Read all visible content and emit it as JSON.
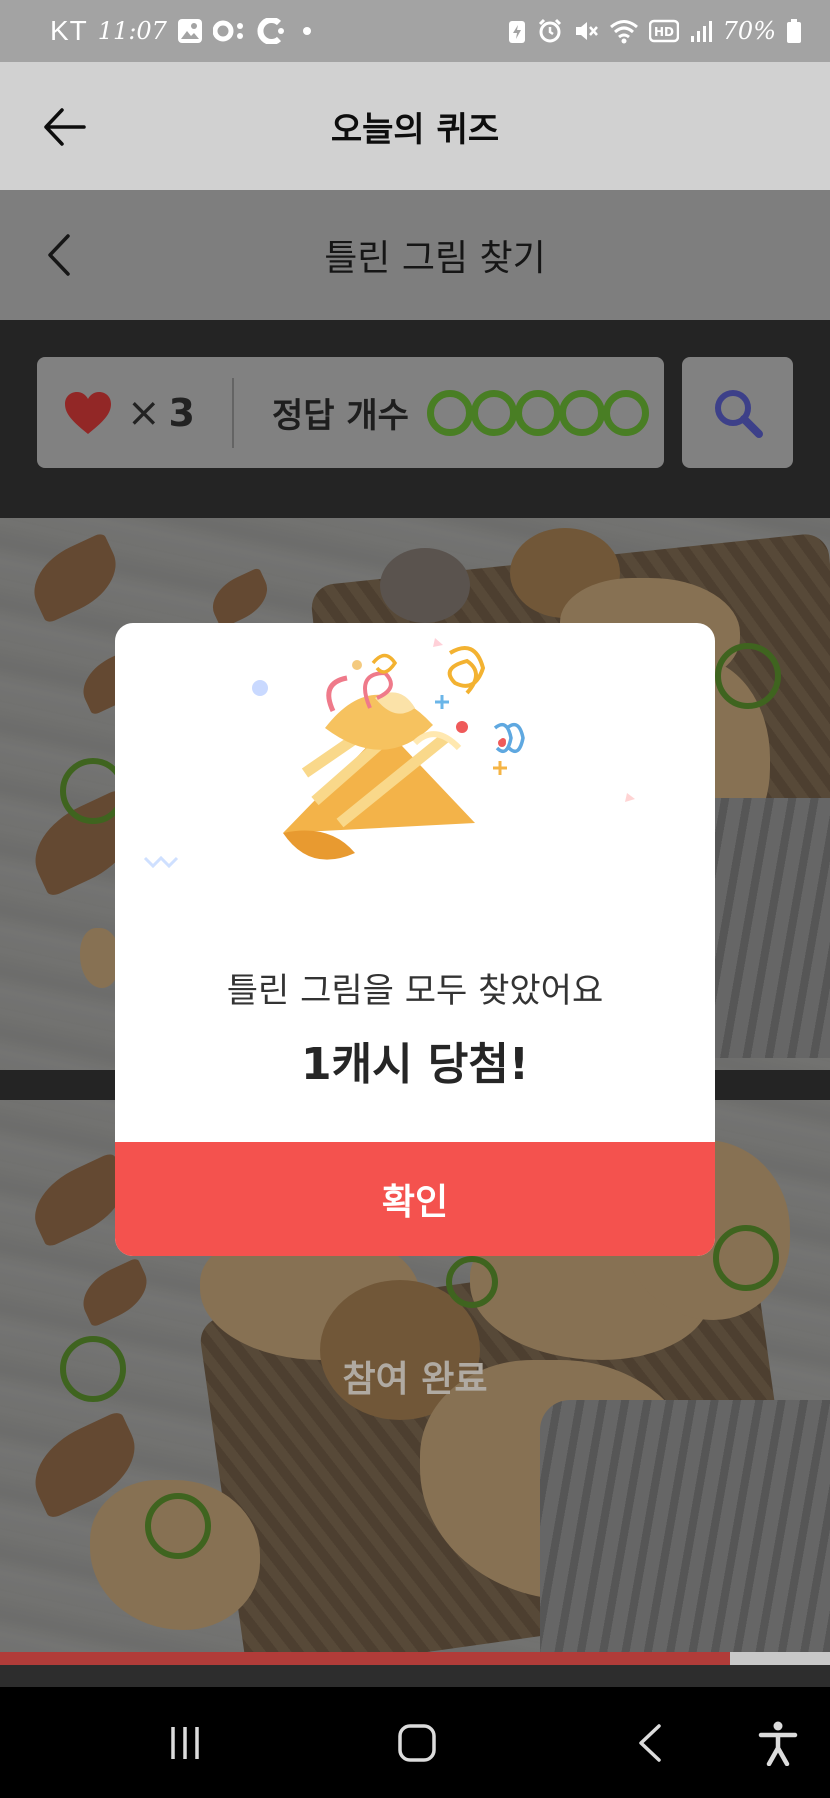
{
  "status_bar": {
    "carrier": "KT",
    "time": "11:07",
    "battery": "70%"
  },
  "header": {
    "title": "오늘의 퀴즈"
  },
  "quiz": {
    "title": "틀린 그림 찾기",
    "lives_symbol": "×",
    "lives_count": "3",
    "answers_label": "정답 개수",
    "answers_found": 5,
    "answers_total": 5,
    "completed_label": "참여 완료",
    "progress": 0.88
  },
  "modal": {
    "message": "틀린 그림을 모두 찾았어요",
    "prize": "1캐시 당첨!",
    "confirm_label": "확인"
  },
  "colors": {
    "accent": "#f4524e",
    "ring": "#5a9a2c",
    "progress": "#b13c39"
  },
  "nav": {
    "icons": [
      "recent-apps-icon",
      "home-icon",
      "back-icon",
      "accessibility-icon"
    ]
  }
}
